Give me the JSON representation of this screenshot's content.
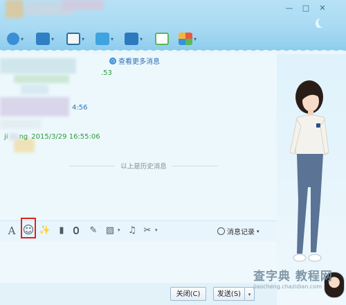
{
  "window": {
    "minimize_glyph": "—",
    "maximize_glyph": "□",
    "close_glyph": "✕"
  },
  "toolbar": {
    "items": [
      {
        "icon": "video-call-icon",
        "color": "#3a8fd6"
      },
      {
        "icon": "screen-share-icon",
        "color": "#2f7fc4"
      },
      {
        "icon": "file-transfer-icon",
        "color": "#3fa3e0"
      },
      {
        "icon": "remote-desktop-icon",
        "color": "#2c79bd"
      },
      {
        "icon": "chat-add-icon",
        "color": "#58b85a"
      },
      {
        "icon": "apps-grid-icon",
        "color": "#e85b3a"
      }
    ]
  },
  "chat": {
    "more_messages_link": "查看更多消息",
    "messages": [
      {
        "time_partial": ".53"
      },
      {
        "time_partial": "4:56"
      },
      {
        "sender_partial": "ji",
        "sender_rest": "ng",
        "timestamp": "2015/3/29 16:55:06"
      }
    ],
    "history_divider": "以上是历史消息"
  },
  "input_toolbar": {
    "font_glyph": "A",
    "smiley_glyph": "☺",
    "magic_glyph": "✨",
    "video_glyph": "▮",
    "mic_glyph": "🎙",
    "edit_glyph": "✎",
    "image_glyph": "▨",
    "music_glyph": "♫",
    "scissors_glyph": "✂",
    "caret_glyph": "▾",
    "message_log_label": "消息记录"
  },
  "buttons": {
    "close_label": "关闭(C)",
    "send_label": "发送(S)",
    "caret": "▾"
  },
  "watermark": {
    "main": "查字典 教程网",
    "sub": "jiaocheng.chazidian.com"
  },
  "colors": {
    "accent_blue": "#2c6fb3",
    "timestamp_green": "#2e9a3a",
    "highlight_red": "#e02020"
  }
}
